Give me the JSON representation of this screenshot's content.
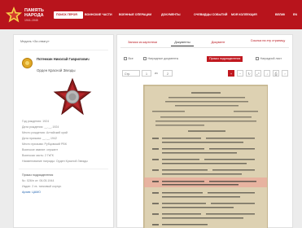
{
  "header": {
    "logo_line1": "ПАМЯТЬ",
    "logo_line2": "НАРОДА",
    "logo_line3": "1941-1945",
    "nav": [
      "ПОИСК ГЕРОЯ",
      "ВОИНСКИЕ ЧАСТИ",
      "ВОЕННЫЕ ОПЕРАЦИИ",
      "ДОКУМЕНТЫ",
      "ОЧЕВИДЦЫ СОБЫТИЙ",
      "МОЯ КОЛЛЕКЦИЯ",
      "ВЕЛИКАЯ ПОБЕДА",
      "EN"
    ]
  },
  "person": {
    "prev_award": "Медаль «За отвагу»",
    "name": "Потенкин Николай Гаврилович",
    "award": "Орден Красной Звезды",
    "fields": [
      "Год рождения: 1924",
      "Дата рождения: __.__.1924",
      "Место рождения: Алтайский край",
      "Дата призыва: __.__.1942",
      "Место призыва: Рубцовский РВК",
      "Воинское звание: сержант",
      "Воинская часть: 2 ГвТК",
      "Наименование награды: Орден Красной Звезды"
    ],
    "links": [
      "Приказ подразделения",
      "№: 026/н от: 06.05.1944",
      "Издан: 2 гв. танковый корпус",
      "Архив: ЦАМО"
    ]
  },
  "tabs": [
    "Записи из картотеки",
    "Документы",
    "Документ",
    "Ссылка на эту страницу"
  ],
  "filters": [
    "Все",
    "Наградные документы",
    "Приказ подразделения",
    "Наградной лист"
  ],
  "toolbar": {
    "page_label": "Стр.",
    "page_value": "1",
    "of_label": "из",
    "total_value": "2"
  },
  "document_title": "ПРИКАЗ"
}
